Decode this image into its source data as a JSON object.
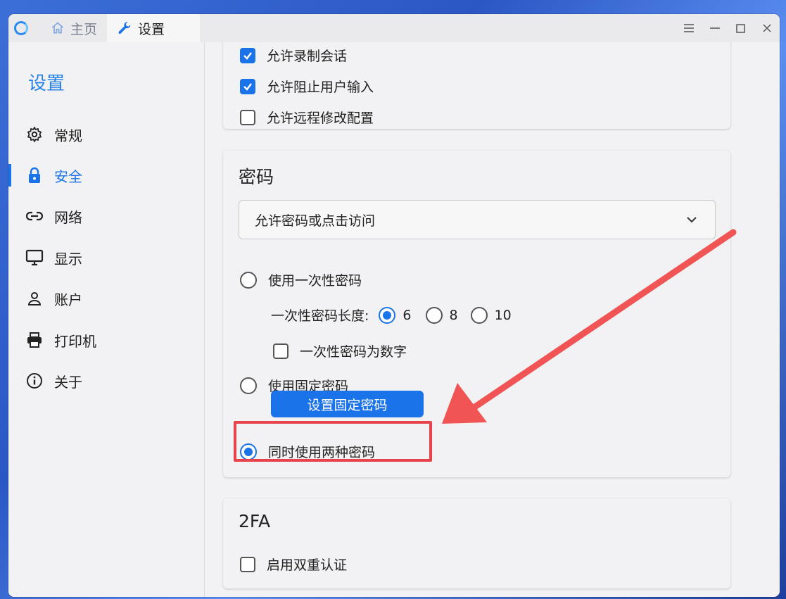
{
  "titlebar": {
    "tabs": [
      {
        "label": "主页",
        "icon": "home-icon",
        "active": false
      },
      {
        "label": "设置",
        "icon": "wrench-icon",
        "active": true
      }
    ],
    "controls": [
      "menu-icon",
      "minimize-icon",
      "maximize-icon",
      "close-icon"
    ]
  },
  "sidebar": {
    "title": "设置",
    "items": [
      {
        "label": "常规",
        "icon": "gear-icon"
      },
      {
        "label": "安全",
        "icon": "lock-icon",
        "active": true
      },
      {
        "label": "网络",
        "icon": "link-icon"
      },
      {
        "label": "显示",
        "icon": "monitor-icon"
      },
      {
        "label": "账户",
        "icon": "user-icon"
      },
      {
        "label": "打印机",
        "icon": "printer-icon"
      },
      {
        "label": "关于",
        "icon": "info-icon"
      }
    ]
  },
  "permissions": {
    "items": [
      {
        "label": "允许录制会话",
        "checked": true
      },
      {
        "label": "允许阻止用户输入",
        "checked": true
      },
      {
        "label": "允许远程修改配置",
        "checked": false
      }
    ]
  },
  "password": {
    "title": "密码",
    "access_mode": "允许密码或点击访问",
    "one_time": {
      "label": "使用一次性密码",
      "selected": false
    },
    "length_label": "一次性密码长度:",
    "lengths": [
      {
        "label": "6",
        "selected": true
      },
      {
        "label": "8",
        "selected": false
      },
      {
        "label": "10",
        "selected": false
      }
    ],
    "numeric": {
      "label": "一次性密码为数字",
      "checked": false
    },
    "fixed": {
      "label": "使用固定密码",
      "selected": false
    },
    "set_fixed_button": "设置固定密码",
    "both": {
      "label": "同时使用两种密码",
      "selected": true
    }
  },
  "twofa": {
    "title": "2FA",
    "enable": {
      "label": "启用双重认证",
      "checked": false
    }
  },
  "colors": {
    "accent": "#1a73e8",
    "annotation": "#e8434a"
  }
}
